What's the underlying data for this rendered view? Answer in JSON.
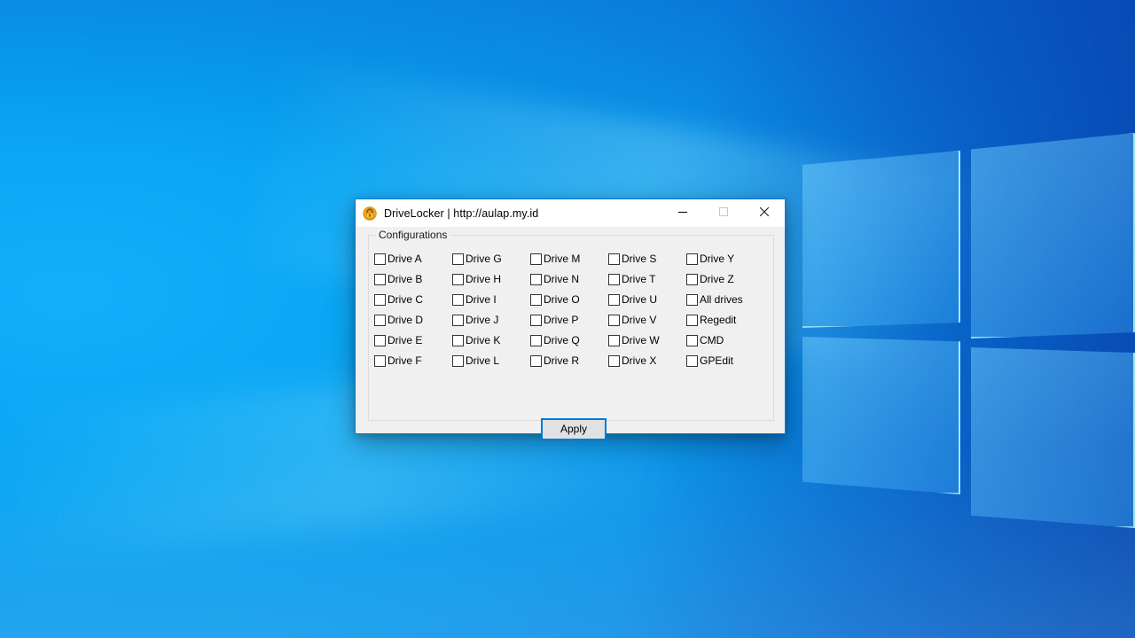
{
  "window": {
    "title": "DriveLocker | http://aulap.my.id",
    "icon": "padlock-icon",
    "accent_color": "#0078D7",
    "caption": {
      "minimize": "—",
      "maximize": "□",
      "close": "✕",
      "minimize_name": "minimize",
      "maximize_name": "maximize",
      "close_name": "close"
    }
  },
  "groupbox": {
    "legend": "Configurations"
  },
  "checkbox_columns": [
    {
      "items": [
        {
          "label": "Drive A",
          "checked": false
        },
        {
          "label": "Drive B",
          "checked": false
        },
        {
          "label": "Drive C",
          "checked": false
        },
        {
          "label": "Drive D",
          "checked": false
        },
        {
          "label": "Drive E",
          "checked": false
        },
        {
          "label": "Drive F",
          "checked": false
        }
      ]
    },
    {
      "items": [
        {
          "label": "Drive G",
          "checked": false
        },
        {
          "label": "Drive H",
          "checked": false
        },
        {
          "label": "Drive I",
          "checked": false
        },
        {
          "label": "Drive J",
          "checked": false
        },
        {
          "label": "Drive K",
          "checked": false
        },
        {
          "label": "Drive L",
          "checked": false
        }
      ]
    },
    {
      "items": [
        {
          "label": "Drive M",
          "checked": false
        },
        {
          "label": "Drive N",
          "checked": false
        },
        {
          "label": "Drive O",
          "checked": false
        },
        {
          "label": "Drive P",
          "checked": false
        },
        {
          "label": "Drive Q",
          "checked": false
        },
        {
          "label": "Drive R",
          "checked": false
        }
      ]
    },
    {
      "items": [
        {
          "label": "Drive S",
          "checked": false
        },
        {
          "label": "Drive T",
          "checked": false
        },
        {
          "label": "Drive U",
          "checked": false
        },
        {
          "label": "Drive V",
          "checked": false
        },
        {
          "label": "Drive W",
          "checked": false
        },
        {
          "label": "Drive X",
          "checked": false
        }
      ]
    },
    {
      "items": [
        {
          "label": "Drive Y",
          "checked": false
        },
        {
          "label": "Drive Z",
          "checked": false
        },
        {
          "label": "All drives",
          "checked": false
        },
        {
          "label": "Regedit",
          "checked": false
        },
        {
          "label": "CMD",
          "checked": false
        },
        {
          "label": "GPEdit",
          "checked": false
        }
      ]
    }
  ],
  "buttons": {
    "apply": "Apply"
  },
  "desktop": {
    "wallpaper": "windows-10-hero-blue",
    "colors": {
      "wallpaper_light": "#12B0FB",
      "wallpaper_mid": "#0B93E8",
      "wallpaper_dark": "#0F5FD0",
      "logo_glow": "#B4F8FF"
    }
  }
}
